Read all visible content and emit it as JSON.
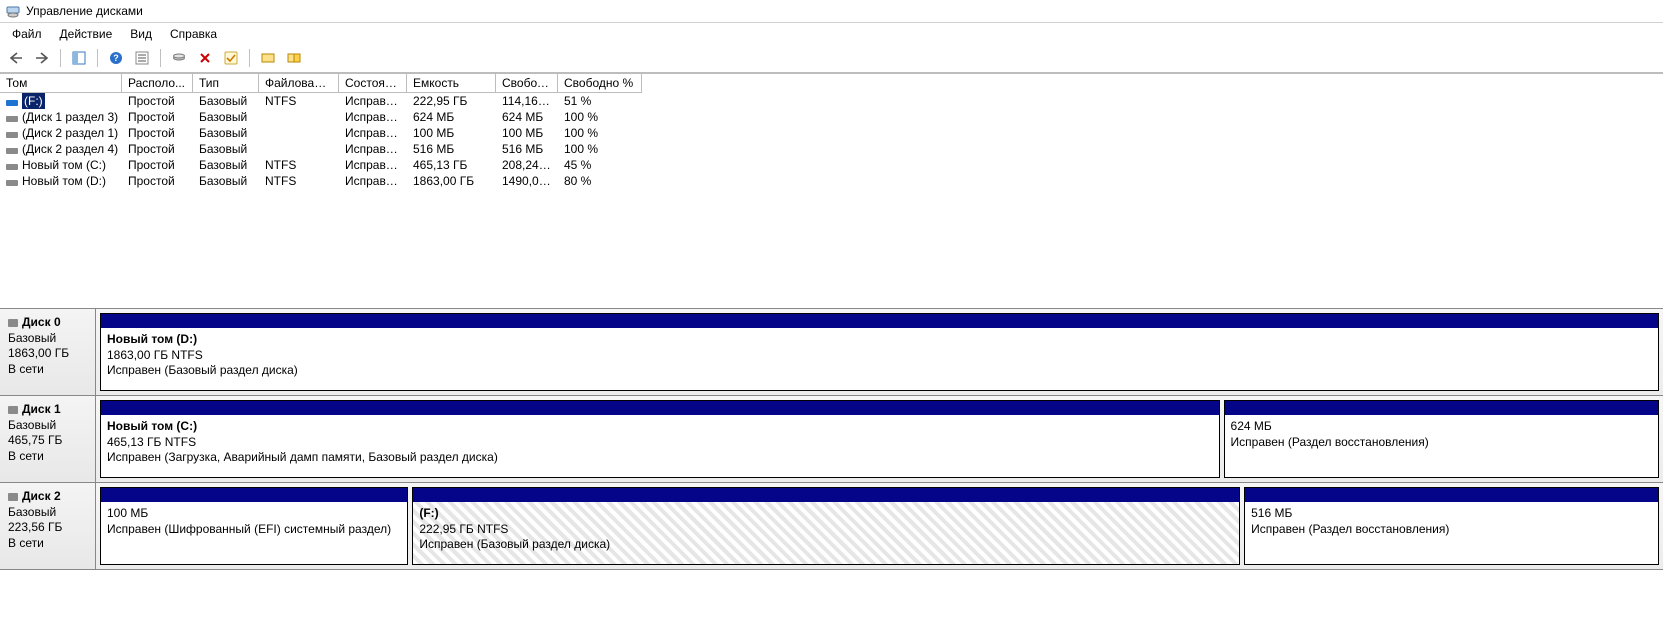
{
  "window": {
    "title": "Управление дисками"
  },
  "menu": {
    "file": "Файл",
    "action": "Действие",
    "view": "Вид",
    "help": "Справка"
  },
  "toolbar": {
    "back": "←",
    "forward": "→",
    "properties": "☰",
    "help": "?",
    "refresh": "↻",
    "delete": "✕",
    "check": "✓",
    "folder1": "📁",
    "folder2": "📂"
  },
  "columns": {
    "volume": "Том",
    "layout": "Располо...",
    "type": "Тип",
    "filesystem": "Файловая с...",
    "status": "Состояние",
    "capacity": "Емкость",
    "free": "Свобод...",
    "freepercent": "Свободно %"
  },
  "volumes": [
    {
      "name": "(F:)",
      "layout": "Простой",
      "type": "Базовый",
      "fs": "NTFS",
      "status": "Исправен...",
      "capacity": "222,95 ГБ",
      "free": "114,16 ГБ",
      "freepct": "51 %",
      "selected": true
    },
    {
      "name": "(Диск 1 раздел 3)",
      "layout": "Простой",
      "type": "Базовый",
      "fs": "",
      "status": "Исправен...",
      "capacity": "624 МБ",
      "free": "624 МБ",
      "freepct": "100 %",
      "selected": false
    },
    {
      "name": "(Диск 2 раздел 1)",
      "layout": "Простой",
      "type": "Базовый",
      "fs": "",
      "status": "Исправен...",
      "capacity": "100 МБ",
      "free": "100 МБ",
      "freepct": "100 %",
      "selected": false
    },
    {
      "name": "(Диск 2 раздел 4)",
      "layout": "Простой",
      "type": "Базовый",
      "fs": "",
      "status": "Исправен...",
      "capacity": "516 МБ",
      "free": "516 МБ",
      "freepct": "100 %",
      "selected": false
    },
    {
      "name": "Новый том (C:)",
      "layout": "Простой",
      "type": "Базовый",
      "fs": "NTFS",
      "status": "Исправен...",
      "capacity": "465,13 ГБ",
      "free": "208,24 ГБ",
      "freepct": "45 %",
      "selected": false
    },
    {
      "name": "Новый том (D:)",
      "layout": "Простой",
      "type": "Базовый",
      "fs": "NTFS",
      "status": "Исправен...",
      "capacity": "1863,00 ГБ",
      "free": "1490,09 ...",
      "freepct": "80 %",
      "selected": false
    }
  ],
  "disks": [
    {
      "name": "Диск 0",
      "type": "Базовый",
      "size": "1863,00 ГБ",
      "state": "В сети",
      "parts": [
        {
          "title": "Новый том  (D:)",
          "line2": "1863,00 ГБ NTFS",
          "line3": "Исправен (Базовый раздел диска)",
          "flex": 1,
          "hatch": false
        }
      ]
    },
    {
      "name": "Диск 1",
      "type": "Базовый",
      "size": "465,75 ГБ",
      "state": "В сети",
      "parts": [
        {
          "title": "Новый том  (C:)",
          "line2": "465,13 ГБ NTFS",
          "line3": "Исправен (Загрузка, Аварийный дамп памяти, Базовый раздел диска)",
          "flex": 33,
          "hatch": false
        },
        {
          "title": "",
          "line2": "624 МБ",
          "line3": "Исправен (Раздел восстановления)",
          "flex": 12.8,
          "hatch": false
        }
      ]
    },
    {
      "name": "Диск 2",
      "type": "Базовый",
      "size": "223,56 ГБ",
      "state": "В сети",
      "parts": [
        {
          "title": "",
          "line2": "100 МБ",
          "line3": "Исправен (Шифрованный (EFI) системный раздел)",
          "flex": 9.2,
          "hatch": false
        },
        {
          "title": " (F:)",
          "line2": "222,95 ГБ NTFS",
          "line3": "Исправен (Базовый раздел диска)",
          "flex": 24.8,
          "hatch": true
        },
        {
          "title": "",
          "line2": "516 МБ",
          "line3": "Исправен (Раздел восстановления)",
          "flex": 12.4,
          "hatch": false
        }
      ]
    }
  ]
}
